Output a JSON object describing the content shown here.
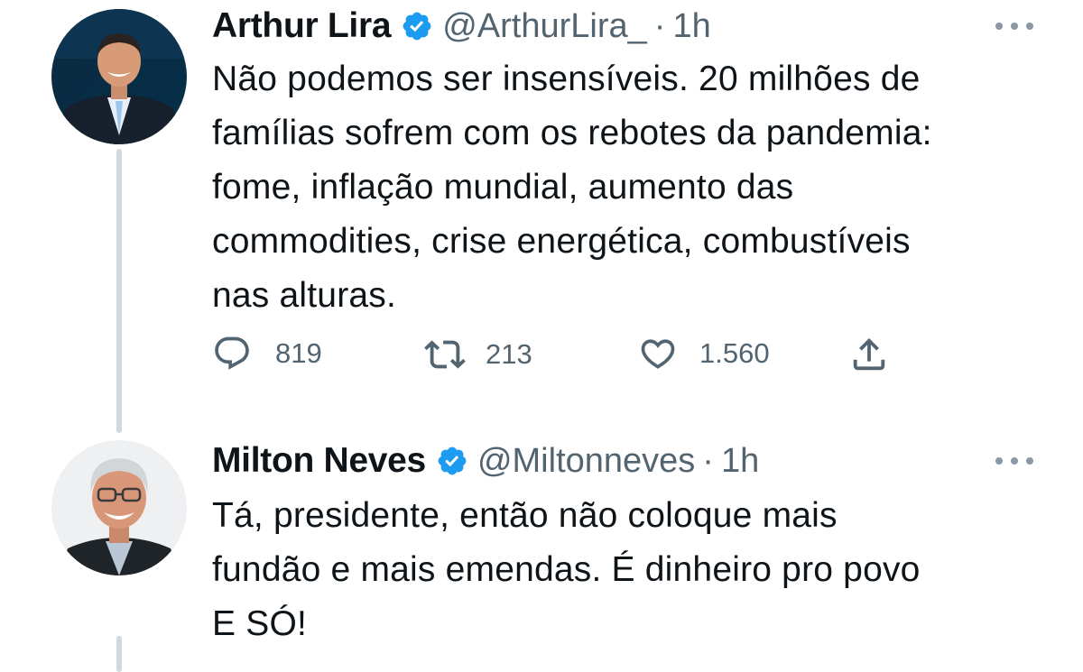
{
  "tweets": [
    {
      "name": "Arthur Lira",
      "handle": "@ArthurLira_",
      "separator": "·",
      "time": "1h",
      "text": "Não podemos ser insensíveis. 20 milhões de\nfamílias sofrem com os rebotes da pandemia:\nfome, inflação mundial, aumento das\ncommodities, crise energética, combustíveis\nnas alturas.",
      "replies": "819",
      "retweets": "213",
      "likes": "1.560"
    },
    {
      "name": "Milton Neves",
      "handle": "@Miltonneves",
      "separator": "·",
      "time": "1h",
      "text": "Tá, presidente, então não coloque mais\nfundão e mais emendas. É dinheiro pro povo\nE SÓ!"
    }
  ],
  "colors": {
    "verified": "#1d9bf0",
    "muted": "#536471",
    "thread_line": "#cfd9de",
    "text": "#0f1419"
  },
  "icons": [
    "verified-badge-icon",
    "more-options-icon",
    "reply-icon",
    "retweet-icon",
    "like-icon",
    "share-icon"
  ]
}
